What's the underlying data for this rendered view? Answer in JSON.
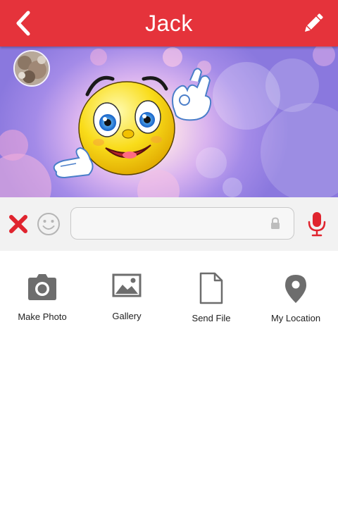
{
  "header": {
    "title": "Jack",
    "back_icon": "chevron-left-icon",
    "edit_icon": "pencil-icon",
    "color": "#e5333b"
  },
  "banner": {
    "avatar_icon": "avatar-photo",
    "image": "winking-emoji-ok-hand-sticker"
  },
  "composer": {
    "cancel_icon": "close-x-icon",
    "emoji_icon": "smiley-icon",
    "message_value": "",
    "message_placeholder": "",
    "lock_icon": "lock-icon",
    "mic_icon": "microphone-icon",
    "accent": "#e0242e"
  },
  "attachments": [
    {
      "label": "Make Photo",
      "icon": "camera-icon"
    },
    {
      "label": "Gallery",
      "icon": "image-icon"
    },
    {
      "label": "Send File",
      "icon": "file-icon"
    },
    {
      "label": "My Location",
      "icon": "location-pin-icon"
    }
  ]
}
